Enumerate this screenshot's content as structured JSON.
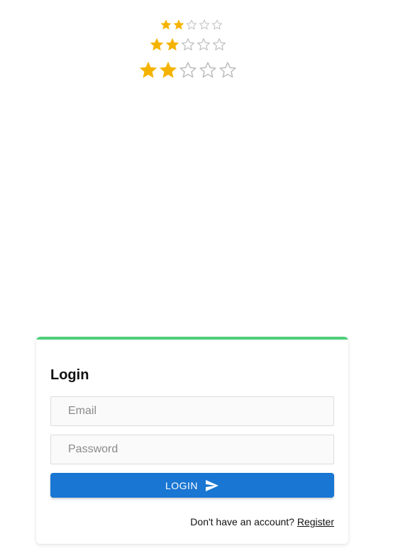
{
  "ratings": [
    {
      "value": 2,
      "max": 5,
      "size": "small"
    },
    {
      "value": 2,
      "max": 5,
      "size": "medium"
    },
    {
      "value": 2,
      "max": 5,
      "size": "large"
    }
  ],
  "colors": {
    "star_filled": "#f5b301",
    "star_empty": "#bdbdbd",
    "accent_bar": "#4ecf7a",
    "primary_button": "#1976d2"
  },
  "login": {
    "title": "Login",
    "email_placeholder": "Email",
    "password_placeholder": "Password",
    "button_label": "LOGIN",
    "button_icon": "send-icon",
    "register_prompt": "Don't have an account?",
    "register_link": "Register"
  }
}
